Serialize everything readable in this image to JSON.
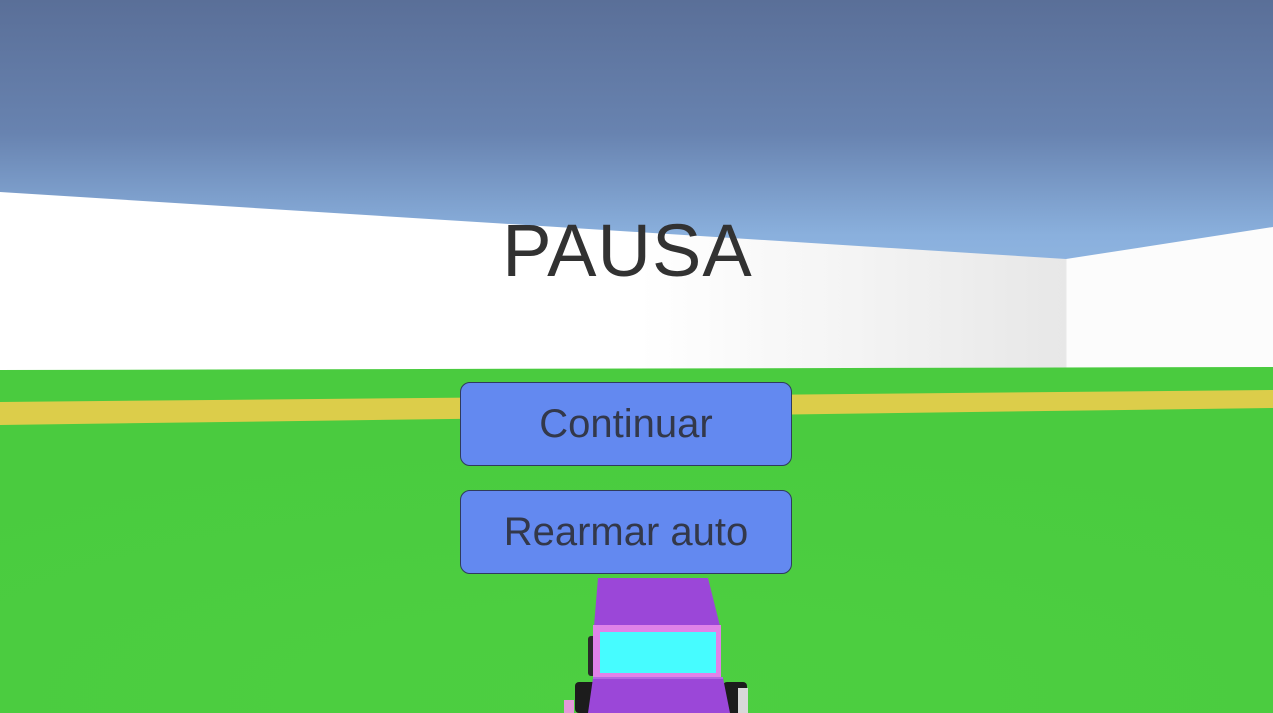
{
  "pause_menu": {
    "title": "PAUSA",
    "continue_label": "Continuar",
    "rearm_label": "Rearmar auto"
  },
  "colors": {
    "sky_top": "#5a6f98",
    "sky_bottom": "#9cc0ea",
    "wall": "#ffffff",
    "grass": "#4ccd40",
    "road_line": "#dccd4a",
    "button_fill": "#6389f0",
    "car_body": "#9b47d8",
    "car_window": "#46fcff"
  }
}
